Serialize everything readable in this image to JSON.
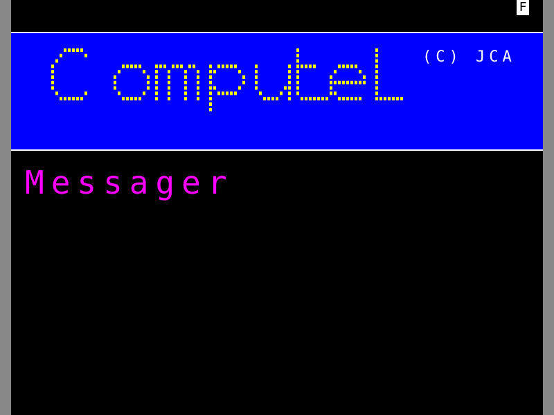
{
  "status_flag": "F",
  "banner": {
    "logo_text": "Computel",
    "copyright": "(C) JCA"
  },
  "service_title": "Messager",
  "colors": {
    "banner_bg": "#0000ff",
    "logo": "#ffff00",
    "copyright": "#ffffff",
    "title": "#ff00ff",
    "screen_bg": "#000000"
  }
}
